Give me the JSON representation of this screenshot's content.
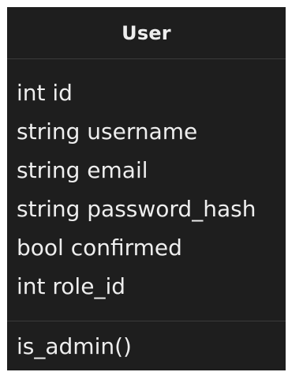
{
  "class": {
    "name": "User",
    "attributes": [
      "int id",
      "string username",
      "string email",
      "string password_hash",
      "bool confirmed",
      "int role_id"
    ],
    "methods": [
      "is_admin()"
    ]
  },
  "colors": {
    "background": "#1e1e1e",
    "text": "#eeeeee",
    "divider": "#3a3a3a"
  }
}
